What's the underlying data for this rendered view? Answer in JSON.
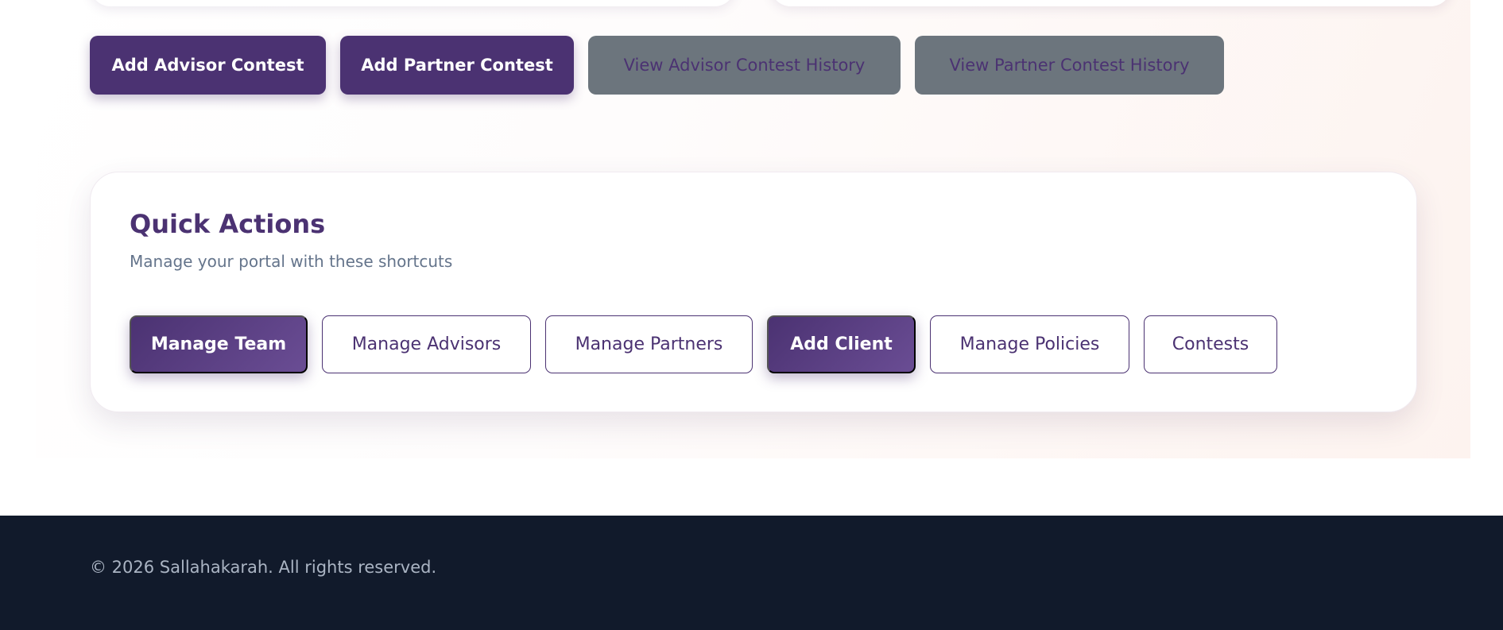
{
  "contest_actions": {
    "add_advisor_contest": "Add Advisor Contest",
    "add_partner_contest": "Add Partner Contest",
    "view_advisor_history": "View Advisor Contest History",
    "view_partner_history": "View Partner Contest History"
  },
  "quick_actions": {
    "title": "Quick Actions",
    "subtitle": "Manage your portal with these shortcuts",
    "buttons": [
      {
        "label": "Manage Team",
        "style": "solid"
      },
      {
        "label": "Manage Advisors",
        "style": "outline"
      },
      {
        "label": "Manage Partners",
        "style": "outline"
      },
      {
        "label": "Add Client",
        "style": "solid"
      },
      {
        "label": "Manage Policies",
        "style": "outline"
      },
      {
        "label": "Contests",
        "style": "outline"
      }
    ]
  },
  "footer": {
    "copyright": "© 2026 Sallahakarah. All rights reserved."
  },
  "colors": {
    "brand_purple": "#4b3272",
    "muted_gray": "#6c757d",
    "footer_bg": "#111a2b",
    "subtitle_gray": "#64748b"
  }
}
